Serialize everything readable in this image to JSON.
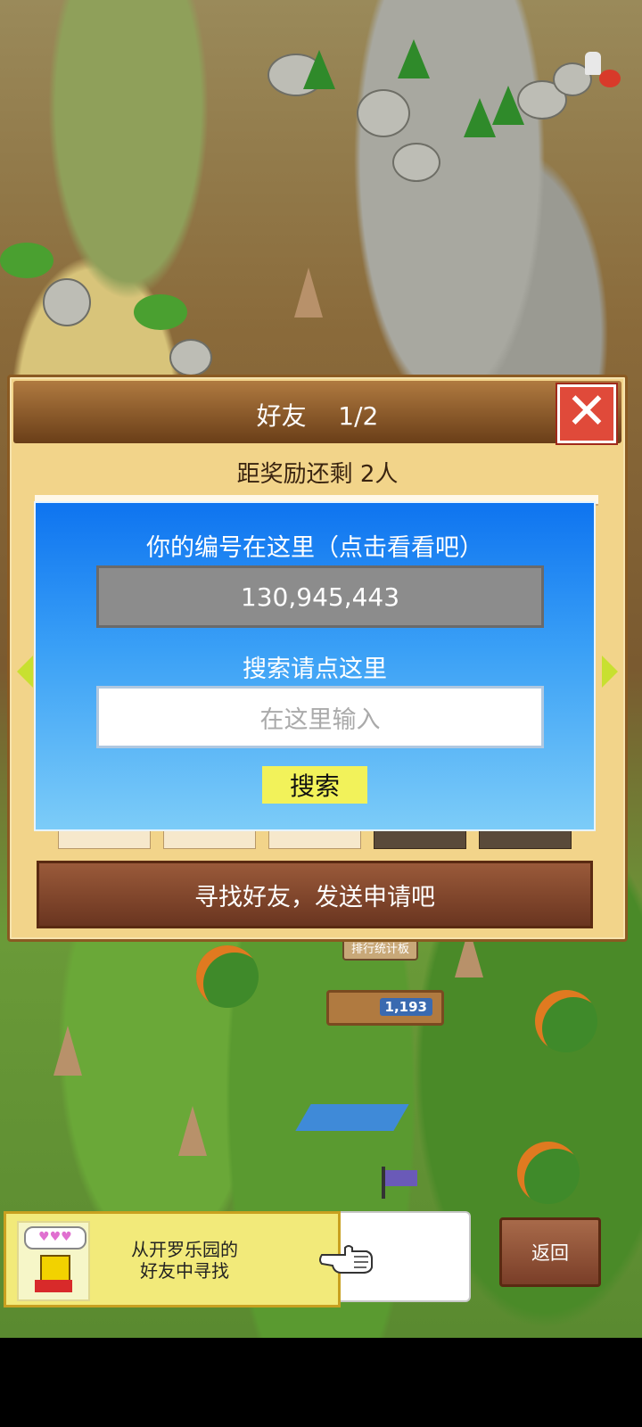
{
  "dialog": {
    "title": "好友    1/2",
    "close_icon": "close-icon",
    "reward_text": "距奖励还剩 2人",
    "find_friends_label": "寻找好友，发送申请吧"
  },
  "id_panel": {
    "label": "你的编号在这里（点击看看吧）",
    "id_value": "130,945,443",
    "search_label": "搜索请点这里",
    "search_placeholder": "在这里输入",
    "search_button": "搜索"
  },
  "world": {
    "ranking_sign": "排行统计板",
    "counter_value": "1,193"
  },
  "bottom": {
    "banner_line1": "从开罗乐园的",
    "banner_line2": "好友中寻找",
    "mascot_hearts": "♥♥♥",
    "back_label": "返回"
  },
  "colors": {
    "panel_blue": "#0e74f0",
    "close_red": "#e04a3a",
    "search_button": "#f2f25a",
    "dialog_bg": "#f2d48a"
  }
}
